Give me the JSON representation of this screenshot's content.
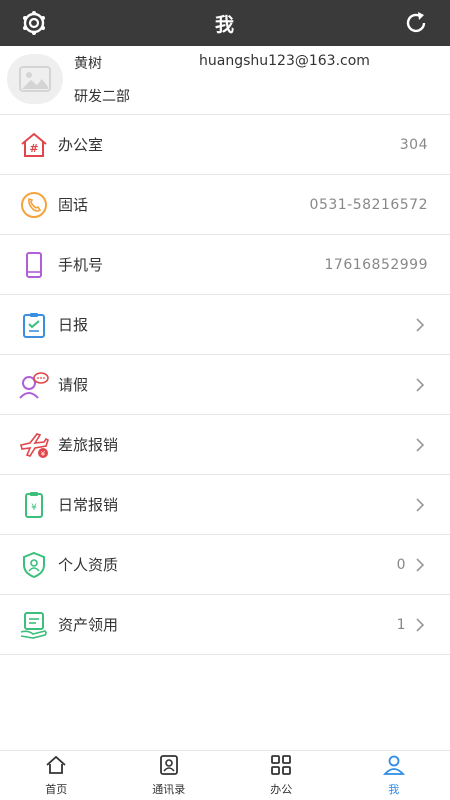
{
  "header": {
    "title": "我",
    "left_icon": "settings-gear-icon",
    "right_icon": "refresh-icon",
    "background": "#3a3a3a"
  },
  "profile": {
    "name": "黄树",
    "email": "huangshu123@163.com",
    "department": "研发二部"
  },
  "menu": [
    {
      "label": "办公室",
      "value": "304",
      "icon": "office-icon"
    },
    {
      "label": "固话",
      "value": "0531-58216572",
      "icon": "phone-icon"
    },
    {
      "label": "手机号",
      "value": "17616852999",
      "icon": "mobile-icon"
    },
    {
      "label": "日报",
      "value": "",
      "icon": "daily-report-icon"
    },
    {
      "label": "请假",
      "value": "",
      "icon": "leave-icon"
    },
    {
      "label": "差旅报销",
      "value": "",
      "icon": "travel-reimbursement-icon"
    },
    {
      "label": "日常报销",
      "value": "",
      "icon": "daily-reimbursement-icon"
    },
    {
      "label": "个人资质",
      "value": "0",
      "icon": "qualification-icon"
    },
    {
      "label": "资产领用",
      "value": "1",
      "icon": "asset-icon"
    }
  ],
  "tabs": [
    {
      "label": "首页",
      "icon": "home-icon"
    },
    {
      "label": "通讯录",
      "icon": "contacts-icon"
    },
    {
      "label": "办公",
      "icon": "office-grid-icon"
    },
    {
      "label": "我",
      "icon": "user-icon",
      "active": true
    }
  ],
  "colors": {
    "accent": "#2f8ce6",
    "red": "#e0474c",
    "orange": "#f5a13c",
    "purple": "#b05fd9",
    "green": "#3bbf7b",
    "blue": "#3a8fe0"
  }
}
